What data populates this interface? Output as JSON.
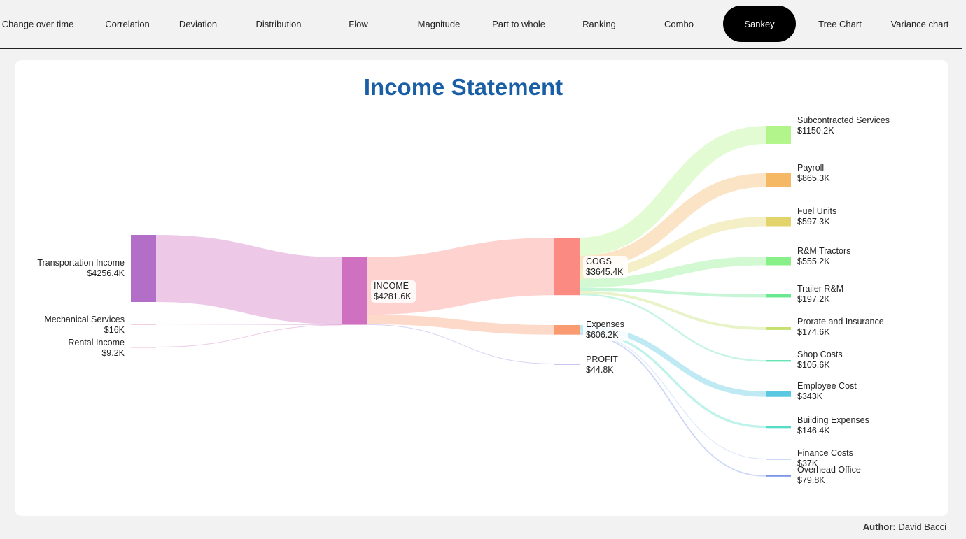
{
  "nav": {
    "tabs": [
      {
        "label": "Change over time",
        "name": "tab-change-over-time",
        "active": false
      },
      {
        "label": "Correlation",
        "name": "tab-correlation",
        "active": false
      },
      {
        "label": "Deviation",
        "name": "tab-deviation",
        "active": false
      },
      {
        "label": "Distribution",
        "name": "tab-distribution",
        "active": false
      },
      {
        "label": "Flow",
        "name": "tab-flow",
        "active": false
      },
      {
        "label": "Magnitude",
        "name": "tab-magnitude",
        "active": false
      },
      {
        "label": "Part to whole",
        "name": "tab-part-to-whole",
        "active": false
      },
      {
        "label": "Ranking",
        "name": "tab-ranking",
        "active": false
      },
      {
        "label": "Combo",
        "name": "tab-combo",
        "active": false
      },
      {
        "label": "Sankey",
        "name": "tab-sankey",
        "active": true
      },
      {
        "label": "Tree Chart",
        "name": "tab-tree-chart",
        "active": false
      },
      {
        "label": "Variance chart",
        "name": "tab-variance-chart",
        "active": false
      }
    ]
  },
  "footer": {
    "author_label": "Author:",
    "author_name": "David Bacci"
  },
  "chart_data": {
    "type": "sankey",
    "title": "Income Statement",
    "unit": "$K",
    "nodes": [
      {
        "id": "transport",
        "name": "Transportation Income",
        "value": "$4256.4K",
        "color": "#b36fc8"
      },
      {
        "id": "mech",
        "name": "Mechanical Services",
        "value": "$16K",
        "color": "#e8a0b8"
      },
      {
        "id": "rental",
        "name": "Rental Income",
        "value": "$9.2K",
        "color": "#f0b8c8"
      },
      {
        "id": "income",
        "name": "INCOME",
        "value": "$4281.6K",
        "color": "#d070c0"
      },
      {
        "id": "cogs",
        "name": "COGS",
        "value": "$3645.4K",
        "color": "#fa8a82"
      },
      {
        "id": "expenses",
        "name": "Expenses",
        "value": "$606.2K",
        "color": "#f99a70"
      },
      {
        "id": "profit",
        "name": "PROFIT",
        "value": "$44.8K",
        "color": "#9a8ee0"
      },
      {
        "id": "subcon",
        "name": "Subcontracted Services",
        "value": "$1150.2K",
        "color": "#b2f58a"
      },
      {
        "id": "payroll",
        "name": "Payroll",
        "value": "$865.3K",
        "color": "#f5b966"
      },
      {
        "id": "fuel",
        "name": "Fuel Units",
        "value": "$597.3K",
        "color": "#e2d46a"
      },
      {
        "id": "rmtract",
        "name": "R&M Tractors",
        "value": "$555.2K",
        "color": "#88f088"
      },
      {
        "id": "trailer",
        "name": "Trailer R&M",
        "value": "$197.2K",
        "color": "#6ae890"
      },
      {
        "id": "prorate",
        "name": "Prorate and Insurance",
        "value": "$174.6K",
        "color": "#c6e070"
      },
      {
        "id": "shop",
        "name": "Shop Costs",
        "value": "$105.6K",
        "color": "#66e4b4"
      },
      {
        "id": "employee",
        "name": "Employee Cost",
        "value": "$343K",
        "color": "#5ac8e0"
      },
      {
        "id": "building",
        "name": "Building Expenses",
        "value": "$146.4K",
        "color": "#55dcc8"
      },
      {
        "id": "finance",
        "name": "Finance Costs",
        "value": "$37K",
        "color": "#9ab8f0"
      },
      {
        "id": "overhead",
        "name": "Overhead Office",
        "value": "$79.8K",
        "color": "#7c96e8"
      }
    ],
    "links": [
      {
        "source": "transport",
        "target": "income",
        "value": 4256.4
      },
      {
        "source": "mech",
        "target": "income",
        "value": 16
      },
      {
        "source": "rental",
        "target": "income",
        "value": 9.2
      },
      {
        "source": "income",
        "target": "cogs",
        "value": 3645.4
      },
      {
        "source": "income",
        "target": "expenses",
        "value": 606.2
      },
      {
        "source": "income",
        "target": "profit",
        "value": 44.8
      },
      {
        "source": "cogs",
        "target": "subcon",
        "value": 1150.2
      },
      {
        "source": "cogs",
        "target": "payroll",
        "value": 865.3
      },
      {
        "source": "cogs",
        "target": "fuel",
        "value": 597.3
      },
      {
        "source": "cogs",
        "target": "rmtract",
        "value": 555.2
      },
      {
        "source": "cogs",
        "target": "trailer",
        "value": 197.2
      },
      {
        "source": "cogs",
        "target": "prorate",
        "value": 174.6
      },
      {
        "source": "cogs",
        "target": "shop",
        "value": 105.6
      },
      {
        "source": "expenses",
        "target": "employee",
        "value": 343
      },
      {
        "source": "expenses",
        "target": "building",
        "value": 146.4
      },
      {
        "source": "expenses",
        "target": "finance",
        "value": 37
      },
      {
        "source": "expenses",
        "target": "overhead",
        "value": 79.8
      }
    ]
  }
}
